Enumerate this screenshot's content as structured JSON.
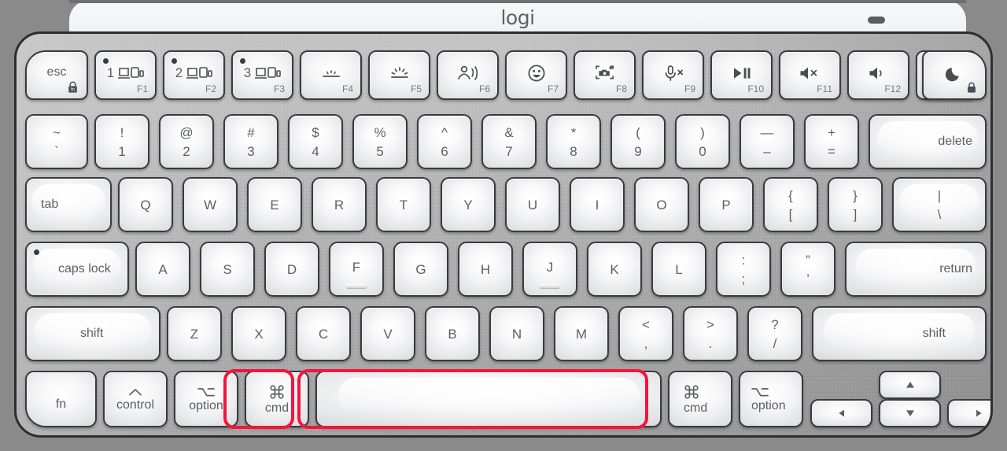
{
  "device": {
    "brand_wordmark": "logi",
    "product_hint": "wireless keyboard",
    "led_indicator": "status-led"
  },
  "colors": {
    "frame": "#8a8a8a",
    "body_metal": "#b6b6b6",
    "key_face": "#f4f5f6",
    "legend": "#5c5f63",
    "highlight": "#f4143c",
    "bezel": "#f4f5f7"
  },
  "highlights": [
    {
      "target": "cmd-left",
      "label": "cmd"
    },
    {
      "target": "space",
      "label": "space"
    }
  ],
  "rows": {
    "function_row": [
      {
        "name": "esc",
        "label": "esc",
        "fn": "",
        "icon": "fn-lock-icon",
        "dot": false
      },
      {
        "name": "f1",
        "label": "1",
        "fn": "F1",
        "icon": "switch-device-1-icon",
        "dot": true
      },
      {
        "name": "f2",
        "label": "2",
        "fn": "F2",
        "icon": "switch-device-2-icon",
        "dot": true
      },
      {
        "name": "f3",
        "label": "3",
        "fn": "F3",
        "icon": "switch-device-3-icon",
        "dot": true
      },
      {
        "name": "f4",
        "label": "",
        "fn": "F4",
        "icon": "backlight-down-icon",
        "dot": false
      },
      {
        "name": "f5",
        "label": "",
        "fn": "F5",
        "icon": "backlight-up-icon",
        "dot": false
      },
      {
        "name": "f6",
        "label": "",
        "fn": "F6",
        "icon": "dictation-icon",
        "dot": false
      },
      {
        "name": "f7",
        "label": "",
        "fn": "F7",
        "icon": "emoji-icon",
        "dot": false
      },
      {
        "name": "f8",
        "label": "",
        "fn": "F8",
        "icon": "screenshot-icon",
        "dot": false
      },
      {
        "name": "f9",
        "label": "",
        "fn": "F9",
        "icon": "mic-mute-icon",
        "dot": false
      },
      {
        "name": "f10",
        "label": "",
        "fn": "F10",
        "icon": "play-pause-icon",
        "dot": false
      },
      {
        "name": "f11",
        "label": "",
        "fn": "F11",
        "icon": "volume-mute-icon",
        "dot": false
      },
      {
        "name": "f12",
        "label": "",
        "fn": "F12",
        "icon": "volume-down-icon",
        "dot": false
      },
      {
        "name": "f13",
        "label": "",
        "fn": "",
        "icon": "volume-up-icon",
        "dot": false
      },
      {
        "name": "sleep",
        "label": "",
        "fn": "",
        "icon": "moon-sleep-icon",
        "dot": false
      }
    ],
    "number_row": [
      {
        "name": "backtick",
        "top": "~",
        "bot": "`"
      },
      {
        "name": "one",
        "top": "!",
        "bot": "1"
      },
      {
        "name": "two",
        "top": "@",
        "bot": "2"
      },
      {
        "name": "three",
        "top": "#",
        "bot": "3"
      },
      {
        "name": "four",
        "top": "$",
        "bot": "4"
      },
      {
        "name": "five",
        "top": "%",
        "bot": "5"
      },
      {
        "name": "six",
        "top": "^",
        "bot": "6"
      },
      {
        "name": "seven",
        "top": "&",
        "bot": "7"
      },
      {
        "name": "eight",
        "top": "*",
        "bot": "8"
      },
      {
        "name": "nine",
        "top": "(",
        "bot": "9"
      },
      {
        "name": "zero",
        "top": ")",
        "bot": "0"
      },
      {
        "name": "minus",
        "top": "—",
        "bot": "–"
      },
      {
        "name": "equal",
        "top": "+",
        "bot": "="
      },
      {
        "name": "delete",
        "top": "",
        "bot": "delete"
      }
    ],
    "top_row": [
      {
        "name": "tab",
        "label": "tab"
      },
      {
        "name": "q",
        "label": "Q"
      },
      {
        "name": "w",
        "label": "W"
      },
      {
        "name": "e",
        "label": "E"
      },
      {
        "name": "r",
        "label": "R"
      },
      {
        "name": "t",
        "label": "T"
      },
      {
        "name": "y",
        "label": "Y"
      },
      {
        "name": "u",
        "label": "U"
      },
      {
        "name": "i",
        "label": "I"
      },
      {
        "name": "o",
        "label": "O"
      },
      {
        "name": "p",
        "label": "P"
      },
      {
        "name": "bracket-left",
        "top": "{",
        "bot": "["
      },
      {
        "name": "bracket-right",
        "top": "}",
        "bot": "]"
      },
      {
        "name": "backslash",
        "top": "|",
        "bot": "\\"
      }
    ],
    "home_row": [
      {
        "name": "caps-lock",
        "label": "caps lock"
      },
      {
        "name": "a",
        "label": "A"
      },
      {
        "name": "s",
        "label": "S"
      },
      {
        "name": "d",
        "label": "D"
      },
      {
        "name": "f",
        "label": "F"
      },
      {
        "name": "g",
        "label": "G"
      },
      {
        "name": "h",
        "label": "H"
      },
      {
        "name": "j",
        "label": "J"
      },
      {
        "name": "k",
        "label": "K"
      },
      {
        "name": "l",
        "label": "L"
      },
      {
        "name": "semicolon",
        "top": ":",
        "bot": ";"
      },
      {
        "name": "quote",
        "top": "”",
        "bot": "’"
      },
      {
        "name": "return",
        "label": "return"
      }
    ],
    "bottom_alpha_row": [
      {
        "name": "shift-left",
        "label": "shift"
      },
      {
        "name": "z",
        "label": "Z"
      },
      {
        "name": "x",
        "label": "X"
      },
      {
        "name": "c",
        "label": "C"
      },
      {
        "name": "v",
        "label": "V"
      },
      {
        "name": "b",
        "label": "B"
      },
      {
        "name": "n",
        "label": "N"
      },
      {
        "name": "m",
        "label": "M"
      },
      {
        "name": "comma",
        "top": "<",
        "bot": ","
      },
      {
        "name": "period",
        "top": ">",
        "bot": "."
      },
      {
        "name": "slash",
        "top": "?",
        "bot": "/"
      },
      {
        "name": "shift-right",
        "label": "shift"
      }
    ],
    "modifier_row": [
      {
        "name": "fn",
        "glyph": "",
        "label": "fn"
      },
      {
        "name": "control",
        "glyph": "˄",
        "label": "control"
      },
      {
        "name": "option-left",
        "glyph": "⌥",
        "label": "option"
      },
      {
        "name": "cmd-left",
        "glyph": "⌘",
        "label": "cmd"
      },
      {
        "name": "space",
        "glyph": "",
        "label": ""
      },
      {
        "name": "cmd-right",
        "glyph": "⌘",
        "label": "cmd"
      },
      {
        "name": "option-right",
        "glyph": "⌥",
        "label": "option"
      },
      {
        "name": "arrow-left",
        "glyph": "◀",
        "label": ""
      },
      {
        "name": "arrow-up",
        "glyph": "▲",
        "label": ""
      },
      {
        "name": "arrow-down",
        "glyph": "▼",
        "label": ""
      },
      {
        "name": "arrow-right",
        "glyph": "▶",
        "label": ""
      }
    ]
  }
}
